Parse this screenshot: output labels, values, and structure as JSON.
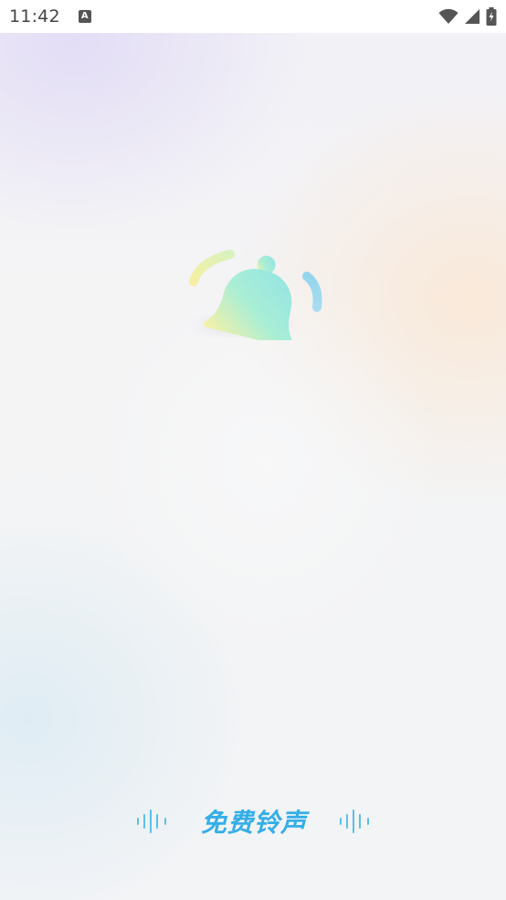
{
  "status_bar": {
    "time": "11:42",
    "notification_glyph": "A",
    "icons": [
      "wifi-icon",
      "cellular-signal-icon",
      "battery-charging-icon"
    ]
  },
  "splash": {
    "logo_icon": "bell-icon",
    "brand_name": "免费铃声",
    "decorations": [
      "sound-wave-icon",
      "sound-wave-icon"
    ]
  },
  "colors": {
    "brand_text": "#34aee8",
    "wave": "#5bbfee",
    "bell_gradient": [
      "#f7ee9c",
      "#a6efd8",
      "#8ee3e6"
    ],
    "status_icons": "#555555"
  }
}
